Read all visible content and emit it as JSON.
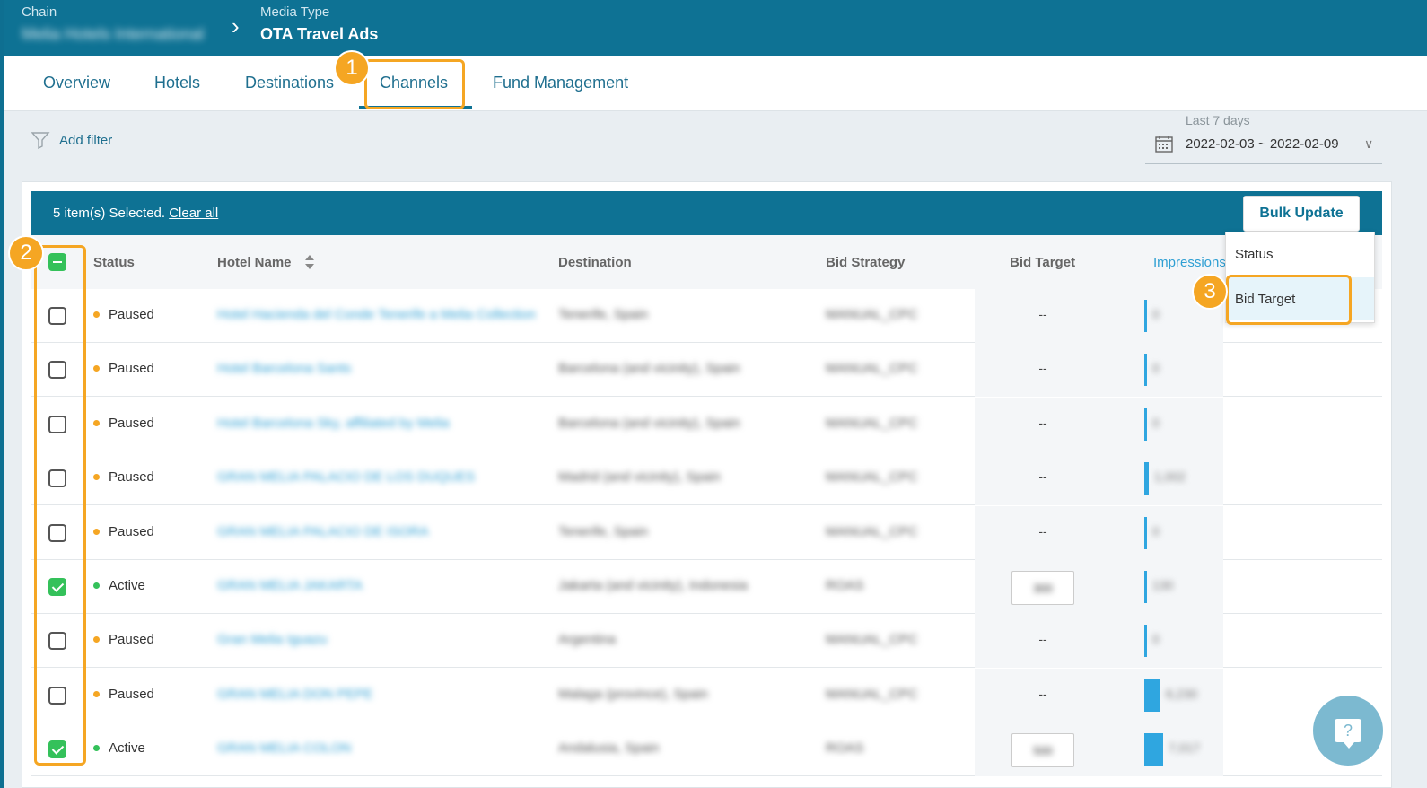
{
  "header": {
    "chain_label": "Chain",
    "chain_value": "Melia Hotels International",
    "media_type_label": "Media Type",
    "media_type_value": "OTA Travel Ads"
  },
  "tabs": [
    {
      "label": "Overview"
    },
    {
      "label": "Hotels"
    },
    {
      "label": "Destinations"
    },
    {
      "label": "Channels"
    },
    {
      "label": "Fund Management"
    }
  ],
  "filter": {
    "add_filter_label": "Add filter"
  },
  "date": {
    "range_label": "Last 7 days",
    "range_value": "2022-02-03 ~ 2022-02-09"
  },
  "selection": {
    "text": "5 item(s) Selected.",
    "clear_label": "Clear all"
  },
  "bulk_update": {
    "label": "Bulk Update",
    "menu": [
      {
        "label": "Status"
      },
      {
        "label": "Bid Target"
      }
    ]
  },
  "table": {
    "columns": [
      "Status",
      "Hotel Name",
      "Destination",
      "Bid Strategy",
      "Bid Target",
      "Impressions"
    ],
    "rows": [
      {
        "status": "Paused",
        "hotel": "Hotel Hacienda del Conde Tenerife a Melia Collection",
        "destination": "Tenerife, Spain",
        "strategy": "MANUAL_CPC",
        "bid_target": "--",
        "impressions": "0",
        "impressions_share": 0.02
      },
      {
        "status": "Paused",
        "hotel": "Hotel Barcelona Sants",
        "destination": "Barcelona (and vicinity), Spain",
        "strategy": "MANUAL_CPC",
        "bid_target": "--",
        "impressions": "0",
        "impressions_share": 0.02
      },
      {
        "status": "Paused",
        "hotel": "Hotel Barcelona Sky, affiliated by Melia",
        "destination": "Barcelona (and vicinity), Spain",
        "strategy": "MANUAL_CPC",
        "bid_target": "--",
        "impressions": "0",
        "impressions_share": 0.02
      },
      {
        "status": "Paused",
        "hotel": "GRAN MELIA PALACIO DE LOS DUQUES",
        "destination": "Madrid (and vicinity), Spain",
        "strategy": "MANUAL_CPC",
        "bid_target": "--",
        "impressions": "1,002",
        "impressions_share": 0.08
      },
      {
        "status": "Paused",
        "hotel": "GRAN MELIA PALACIO DE ISORA",
        "destination": "Tenerife, Spain",
        "strategy": "MANUAL_CPC",
        "bid_target": "--",
        "impressions": "0",
        "impressions_share": 0.02
      },
      {
        "status": "Active",
        "hotel": "GRAN MELIA JAKARTA",
        "destination": "Jakarta (and vicinity), Indonesia",
        "strategy": "ROAS",
        "bid_target": "300",
        "impressions": "130",
        "impressions_share": 0.02
      },
      {
        "status": "Paused",
        "hotel": "Gran Melia Iguazu",
        "destination": "Argentina",
        "strategy": "MANUAL_CPC",
        "bid_target": "--",
        "impressions": "0",
        "impressions_share": 0.02
      },
      {
        "status": "Paused",
        "hotel": "GRAN MELIA DON PEPE",
        "destination": "Malaga (province), Spain",
        "strategy": "MANUAL_CPC",
        "bid_target": "--",
        "impressions": "6,230",
        "impressions_share": 0.3
      },
      {
        "status": "Active",
        "hotel": "GRAN MELIA COLON",
        "destination": "Andalusia, Spain",
        "strategy": "ROAS",
        "bid_target": "500",
        "impressions": "7,017",
        "impressions_share": 0.35
      }
    ],
    "checked": [
      false,
      false,
      false,
      false,
      false,
      true,
      false,
      false,
      true
    ]
  },
  "annotations": [
    "1",
    "2",
    "3"
  ],
  "help": {
    "glyph": "?"
  },
  "colors": {
    "brand": "#0e7294",
    "highlight": "#f5a623",
    "active": "#34c15a",
    "paused": "#f5a623",
    "link": "#2e9fd3"
  }
}
